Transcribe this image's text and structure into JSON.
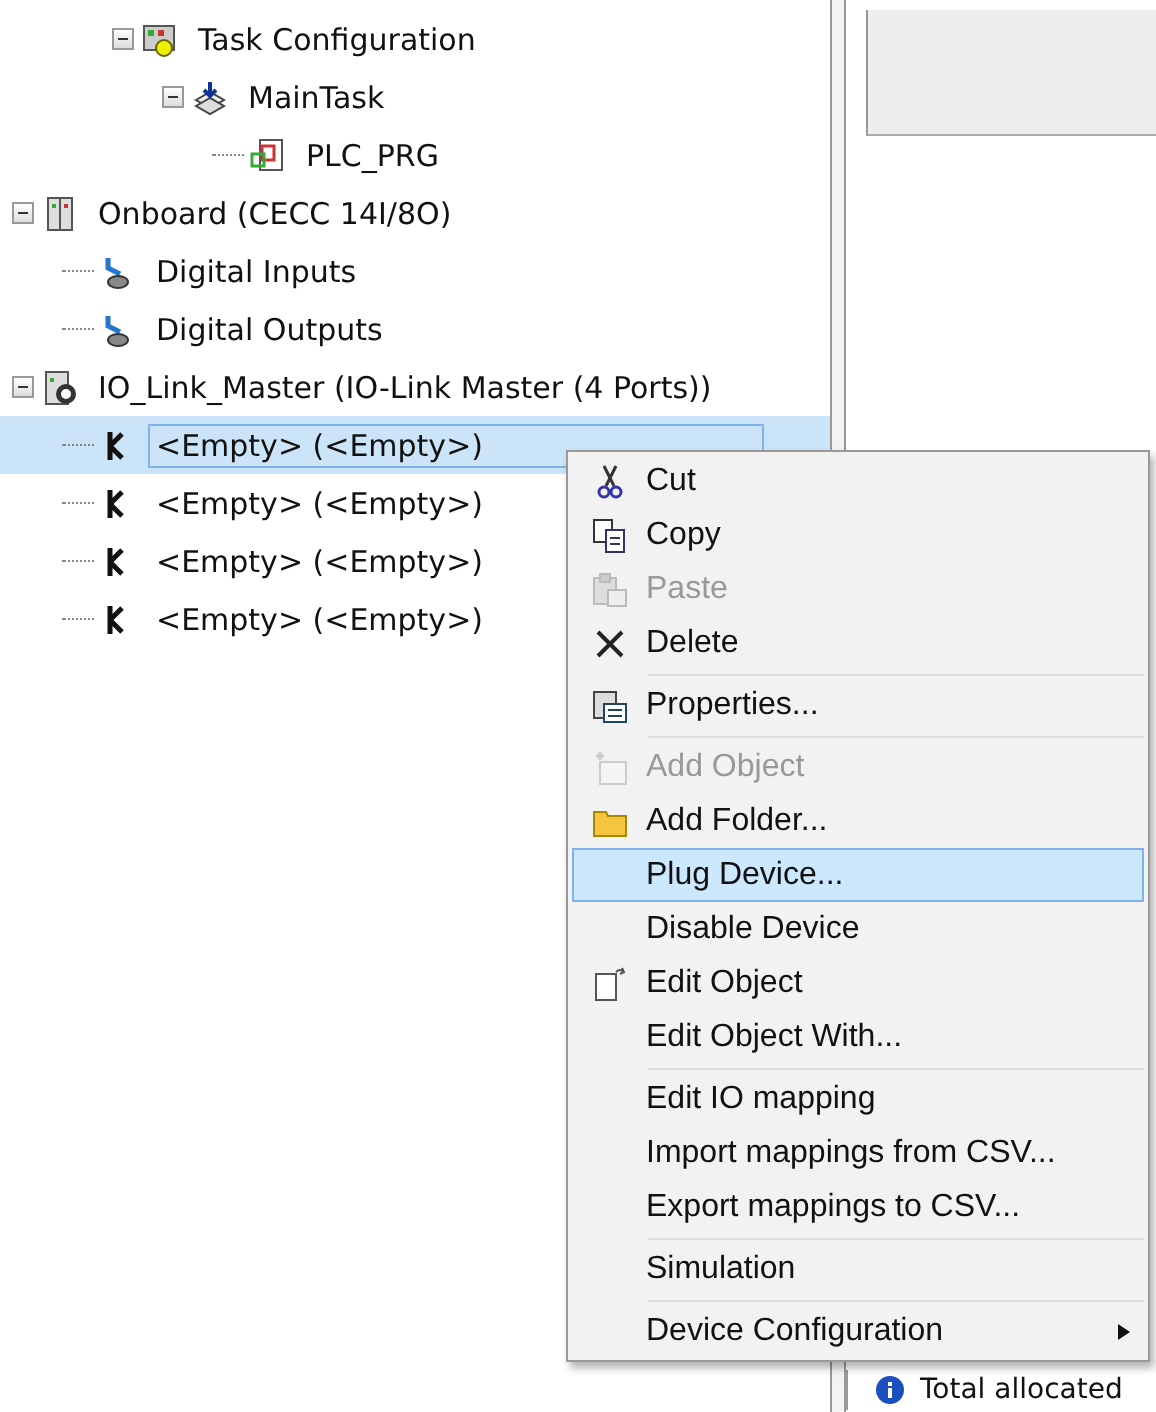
{
  "tree": [
    {
      "children": [
        {
          "children": [
            {
              "label": "Task Configuration",
              "kind": "task-config",
              "expanded": true,
              "selected": false,
              "children": [
                {
                  "label": "MainTask",
                  "kind": "task",
                  "expanded": true,
                  "selected": false,
                  "children": [
                    {
                      "label": "PLC_PRG",
                      "kind": "program",
                      "selected": false
                    }
                  ]
                }
              ]
            }
          ]
        }
      ]
    },
    {
      "label": "Onboard (CECC 14I/8O)",
      "kind": "module",
      "expanded": true,
      "selected": false,
      "children": [
        {
          "label": "Digital Inputs",
          "kind": "io",
          "selected": false
        },
        {
          "label": "Digital Outputs",
          "kind": "io",
          "selected": false
        }
      ]
    },
    {
      "label": "IO_Link_Master (IO-Link Master (4 Ports))",
      "kind": "master",
      "expanded": true,
      "selected": false,
      "children": [
        {
          "label": "<Empty> (<Empty>)",
          "kind": "port",
          "selected": true
        },
        {
          "label": "<Empty> (<Empty>)",
          "kind": "port",
          "selected": false
        },
        {
          "label": "<Empty> (<Empty>)",
          "kind": "port",
          "selected": false
        },
        {
          "label": "<Empty> (<Empty>)",
          "kind": "port",
          "selected": false
        }
      ]
    }
  ],
  "context_menu": [
    {
      "kind": "cut",
      "label": "Cut",
      "disabled": false,
      "selected": false
    },
    {
      "kind": "copy",
      "label": "Copy",
      "disabled": false,
      "selected": false
    },
    {
      "kind": "paste",
      "label": "Paste",
      "disabled": true,
      "selected": false
    },
    {
      "kind": "delete",
      "label": "Delete",
      "disabled": false,
      "selected": false
    },
    {
      "kind": "separator"
    },
    {
      "kind": "properties",
      "label": "Properties...",
      "disabled": false,
      "selected": false
    },
    {
      "kind": "separator"
    },
    {
      "kind": "add-object",
      "label": "Add Object",
      "disabled": true,
      "selected": false
    },
    {
      "kind": "folder",
      "label": "Add Folder...",
      "disabled": false,
      "selected": false
    },
    {
      "kind": "item",
      "label": "Plug Device...",
      "disabled": false,
      "selected": true
    },
    {
      "kind": "item",
      "label": "Disable Device",
      "disabled": false,
      "selected": false
    },
    {
      "kind": "edit",
      "label": "Edit Object",
      "disabled": false,
      "selected": false
    },
    {
      "kind": "item",
      "label": "Edit Object With...",
      "disabled": false,
      "selected": false
    },
    {
      "kind": "separator"
    },
    {
      "kind": "item",
      "label": "Edit IO mapping",
      "disabled": false,
      "selected": false
    },
    {
      "kind": "item",
      "label": "Import mappings from CSV...",
      "disabled": false,
      "selected": false
    },
    {
      "kind": "item",
      "label": "Export mappings to CSV...",
      "disabled": false,
      "selected": false
    },
    {
      "kind": "separator"
    },
    {
      "kind": "item",
      "label": "Simulation",
      "disabled": false,
      "selected": false
    },
    {
      "kind": "separator"
    },
    {
      "kind": "item",
      "label": "Device Configuration",
      "disabled": false,
      "selected": false,
      "submenu": true
    }
  ],
  "message_panel": {
    "text": "Total allocated"
  }
}
